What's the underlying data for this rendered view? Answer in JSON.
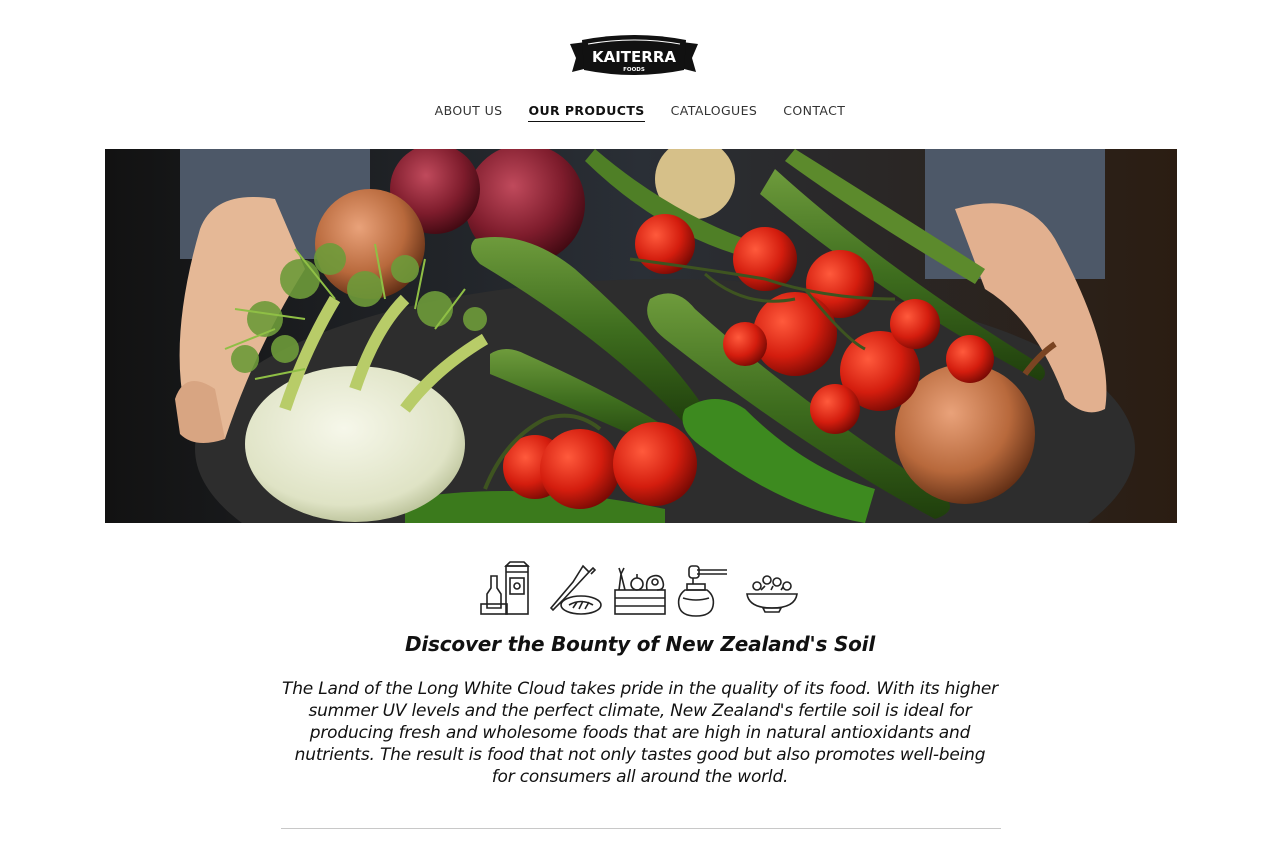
{
  "brand": {
    "name": "KAITERRA",
    "sub": "FOODS"
  },
  "nav": {
    "items": [
      {
        "label": "ABOUT US",
        "active": false
      },
      {
        "label": "OUR PRODUCTS",
        "active": true
      },
      {
        "label": "CATALOGUES",
        "active": false
      },
      {
        "label": "CONTACT",
        "active": false
      }
    ]
  },
  "category_icons": [
    "grocery-icon",
    "knife-bread-icon",
    "produce-crate-icon",
    "honey-jar-icon",
    "salad-bowl-icon"
  ],
  "section": {
    "title": "Discover the Bounty of New Zealand's Soil",
    "body": "The Land of the Long White Cloud takes pride in the quality of its food. With its higher summer UV levels and the perfect climate, New Zealand's fertile soil is ideal for producing fresh and wholesome foods that are high in natural antioxidants and nutrients. The result is food that not only tastes good but also promotes well-being for consumers all around the world."
  },
  "colors": {
    "accent": "#111111",
    "divider": "#c8c8c8"
  }
}
